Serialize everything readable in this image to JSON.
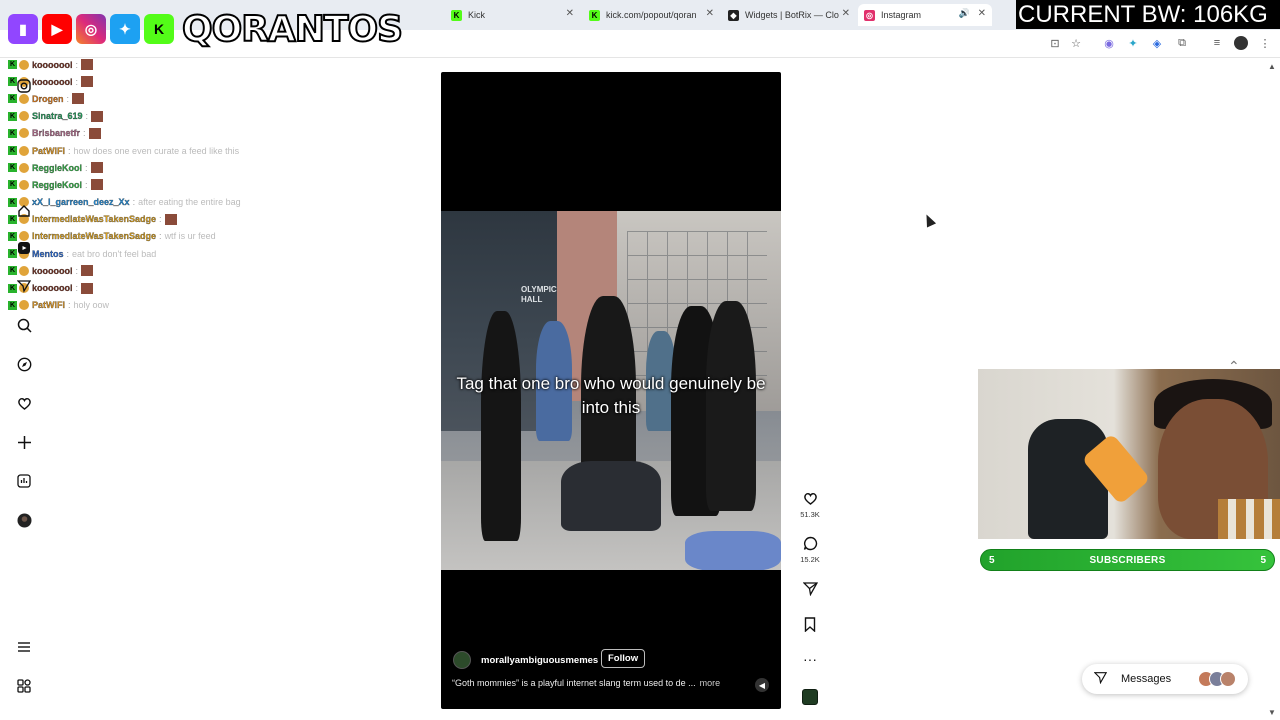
{
  "browser": {
    "tabs": [
      {
        "label": "Kick",
        "icon": "kick-favicon",
        "color": "#53fc18"
      },
      {
        "label": "kick.com/popout/qorantos",
        "icon": "kick-favicon",
        "color": "#53fc18"
      },
      {
        "label": "Widgets | BotRix — Cloud",
        "icon": "botrix-favicon",
        "color": "#222222"
      },
      {
        "label": "Instagram",
        "icon": "instagram-favicon",
        "color": "#e1306c",
        "active": true
      }
    ]
  },
  "overlay": {
    "brand": "QORANTOS",
    "bw_label": "CURRENT BW: 106KG",
    "socials": [
      "twitch-icon",
      "youtube-icon",
      "instagram-icon",
      "twitter-icon",
      "kick-icon"
    ]
  },
  "chat": [
    {
      "user": "kooooool",
      "color": "#6e2b1c",
      "msg": ""
    },
    {
      "user": "kooooool",
      "color": "#6e2b1c",
      "msg": ""
    },
    {
      "user": "Drogen",
      "color": "#e07a17",
      "msg": ""
    },
    {
      "user": "Sinatra_619",
      "color": "#1e9e5a",
      "msg": ""
    },
    {
      "user": "Brisbanetfr",
      "color": "#b36a8c",
      "msg": ""
    },
    {
      "user": "PatWIFI",
      "color": "#e59a1e",
      "msg": "how does one even curate a feed like this"
    },
    {
      "user": "ReggieKool",
      "color": "#2fb344",
      "msg": ""
    },
    {
      "user": "ReggieKool",
      "color": "#2fb344",
      "msg": ""
    },
    {
      "user": "xX_I_garreen_deez_Xx",
      "color": "#1e8fe0",
      "msg": "after eating the entire bag"
    },
    {
      "user": "IntermediateWasTakenSadge",
      "color": "#e0a31a",
      "msg": ""
    },
    {
      "user": "IntermediateWasTakenSadge",
      "color": "#e0a31a",
      "msg": "wtf is ur feed"
    },
    {
      "user": "Mentos",
      "color": "#2468d6",
      "msg": "eat bro don't feel bad"
    },
    {
      "user": "kooooool",
      "color": "#6e2b1c",
      "msg": ""
    },
    {
      "user": "kooooool",
      "color": "#6e2b1c",
      "msg": ""
    },
    {
      "user": "PatWIFI",
      "color": "#e59a1e",
      "msg": "holy oow"
    }
  ],
  "reel": {
    "overlay_text": "Tag that one bro who would genuinely be into this",
    "sign_text": "OLYMPIC HALL",
    "username": "morallyambiguousmemes",
    "follow_label": "Follow",
    "caption": "“Goth mommies” is a playful internet slang term used to de ...",
    "more_label": "more",
    "likes": "51.3K",
    "comments": "15.2K"
  },
  "stream": {
    "subscribers_label": "SUBSCRIBERS",
    "sub_left": "5",
    "sub_right": "5"
  },
  "messages": {
    "label": "Messages"
  }
}
